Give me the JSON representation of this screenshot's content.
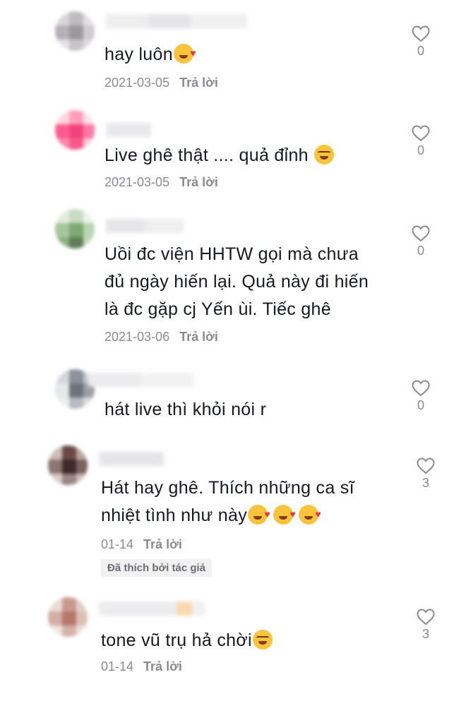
{
  "icons": {
    "like": "heart-outline-icon",
    "love_emoji": "smiling-face-with-hearts-emoji",
    "laugh_emoji": "face-with-tears-of-joy-emoji"
  },
  "colors": {
    "text": "#161823",
    "meta": "#8a8b91",
    "badge_bg": "#f1f1f2"
  },
  "comments": [
    {
      "text": "hay luôn",
      "date": "2021-03-05",
      "reply": "Trả lời",
      "likes": "0"
    },
    {
      "text": "Live ghê thật .... quả đỉnh ",
      "date": "2021-03-05",
      "reply": "Trả lời",
      "likes": "0"
    },
    {
      "text": "Uồi đc viện HHTW gọi mà chưa\nđủ ngày hiến lại. Quả này đi hiến\nlà đc gặp cj Yến ùi. Tiếc ghê",
      "date": "2021-03-06",
      "reply": "Trả lời",
      "likes": "0"
    },
    {
      "text": "hát live thì khỏi nói r",
      "likes": "0"
    },
    {
      "text": "Hát hay ghê. Thích những ca sĩ\nnhiệt tình như này",
      "date": "01-14",
      "reply": "Trả lời",
      "likes": "3",
      "badge": "Đã thích bởi tác giả"
    },
    {
      "text": "tone vũ trụ hả chời",
      "date": "01-14",
      "reply": "Trả lời",
      "likes": "3"
    }
  ]
}
